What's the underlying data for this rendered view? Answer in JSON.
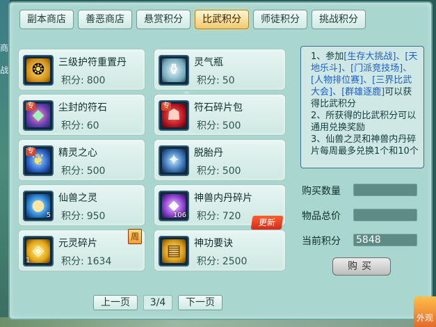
{
  "tabs": [
    {
      "label": "副本商店",
      "active": false
    },
    {
      "label": "善恶商店",
      "active": false
    },
    {
      "label": "悬赏积分",
      "active": false
    },
    {
      "label": "比武积分",
      "active": true
    },
    {
      "label": "师徒积分",
      "active": false
    },
    {
      "label": "挑战积分",
      "active": false
    }
  ],
  "price_label": "积分:",
  "items": [
    {
      "name": "三级护符重置丹",
      "price": "800",
      "icon": "gold-amulet-icon"
    },
    {
      "name": "灵气瓶",
      "price": "50",
      "icon": "spirit-bottle-icon"
    },
    {
      "name": "尘封的符石",
      "price": "60",
      "icon": "sealed-rune-stone-icon",
      "badge": "专"
    },
    {
      "name": "符石碎片包",
      "price": "500",
      "icon": "rune-shard-bag-icon",
      "badge": "专"
    },
    {
      "name": "精灵之心",
      "price": "500",
      "icon": "elf-heart-icon",
      "badge": "专"
    },
    {
      "name": "脱胎丹",
      "price": "500",
      "icon": "rebirth-pill-icon"
    },
    {
      "name": "仙兽之灵",
      "price": "950",
      "icon": "beast-spirit-icon",
      "count": "5"
    },
    {
      "name": "神兽内丹碎片",
      "price": "720",
      "icon": "divine-beast-core-shard-icon",
      "count": "106",
      "tag": "更新"
    },
    {
      "name": "元灵碎片",
      "price": "1634",
      "icon": "soul-shard-icon",
      "count": "1",
      "tag": "周"
    },
    {
      "name": "神功要诀",
      "price": "2500",
      "icon": "martial-manual-icon"
    }
  ],
  "info": {
    "line1_prefix": "1、参加",
    "line1_links": [
      "[生存大挑战]、[天地乐斗]、[门派竞技场]、[人物排位赛]、[三界比武大会]、[群雄逐鹿]"
    ],
    "line1_suffix": "可以获得比武积分",
    "line2": "2、所获得的比武积分可以通用兑换奖励",
    "line3": "3、仙兽之灵和神兽内丹碎片每周最多兑换1个和10个"
  },
  "purchase": {
    "qty_label": "购买数量",
    "qty_value": "",
    "total_label": "物品总价",
    "total_value": "",
    "current_label": "当前积分",
    "current_value": "5848",
    "buy_label": "购买"
  },
  "pager": {
    "prev_label": "上一页",
    "page_info": "3/4",
    "next_label": "下一页"
  },
  "corner": {
    "label": "外观"
  },
  "colors": {
    "panel_bg": "#a9d6cf",
    "tab_active": "#f1c96b",
    "link_blue": "#1b5fc8",
    "field_bg": "#5f8b85"
  }
}
